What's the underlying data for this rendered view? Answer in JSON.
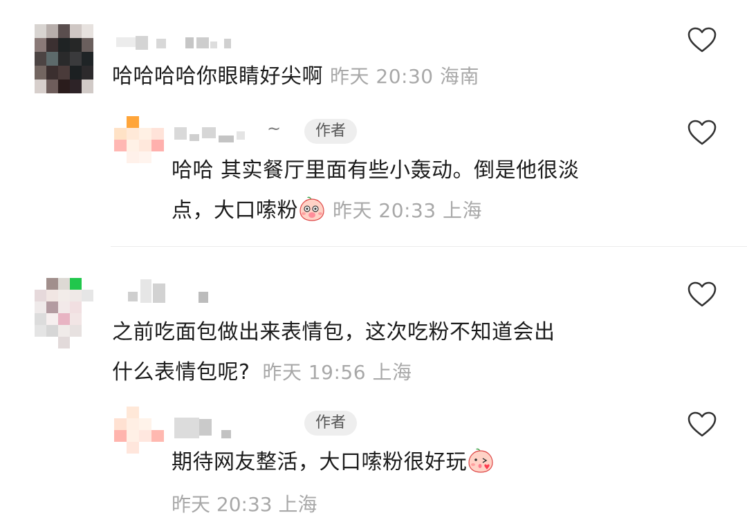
{
  "comments": [
    {
      "text": "哈哈哈哈你眼睛好尖啊",
      "time": "昨天 20:30",
      "location": "海南",
      "reply": {
        "badge": "作者",
        "username_suffix": "~",
        "text_line1": "哈哈 其实餐厅里面有些小轰动。倒是他很淡",
        "text_line2": "点，大口嗦粉",
        "emoji": "blushing-peach-emoji",
        "time": "昨天 20:33",
        "location": "上海"
      }
    },
    {
      "text_line1": "之前吃面包做出来表情包，这次吃粉不知道会出",
      "text_line2": "什么表情包呢?",
      "time": "昨天 19:56",
      "location": "上海",
      "reply": {
        "badge": "作者",
        "text": "期待网友整活，大口嗦粉很好玩",
        "emoji": "kissing-peach-emoji",
        "time": "昨天 20:33",
        "location": "上海"
      }
    }
  ],
  "icons": {
    "like": "heart-outline-icon"
  },
  "colors": {
    "text": "#1b1b1b",
    "meta": "#a8a8a8",
    "badge_bg": "#eeeeee",
    "divider": "#ececec"
  }
}
